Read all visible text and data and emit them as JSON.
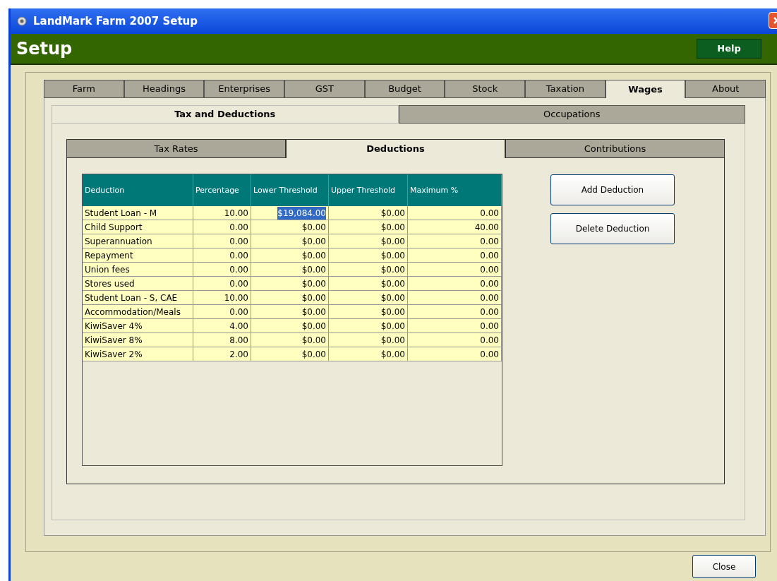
{
  "window": {
    "title": "LandMark Farm 2007 Setup"
  },
  "header": {
    "title": "Setup",
    "help_button": "Help"
  },
  "main_tabs": [
    {
      "label": "Farm",
      "selected": false
    },
    {
      "label": "Headings",
      "selected": false
    },
    {
      "label": "Enterprises",
      "selected": false
    },
    {
      "label": "GST",
      "selected": false
    },
    {
      "label": "Budget",
      "selected": false
    },
    {
      "label": "Stock",
      "selected": false
    },
    {
      "label": "Taxation",
      "selected": false
    },
    {
      "label": "Wages",
      "selected": true
    },
    {
      "label": "About",
      "selected": false
    }
  ],
  "sub_tabs": [
    {
      "label": "Tax and Deductions",
      "selected": true
    },
    {
      "label": "Occupations",
      "selected": false
    }
  ],
  "section_tabs": [
    {
      "label": "Tax Rates",
      "selected": false
    },
    {
      "label": "Deductions",
      "selected": true
    },
    {
      "label": "Contributions",
      "selected": false
    }
  ],
  "table": {
    "columns": [
      "Deduction",
      "Percentage",
      "Lower Threshold",
      "Upper Threshold",
      "Maximum %"
    ],
    "rows": [
      {
        "cells": [
          {
            "text": "Student Loan - M",
            "selected": false
          },
          {
            "text": "10.00",
            "selected": false
          },
          {
            "text": "$19,084.00",
            "selected": true
          },
          {
            "text": "$0.00",
            "selected": false
          },
          {
            "text": "0.00",
            "selected": false
          }
        ]
      },
      {
        "cells": [
          {
            "text": "Child Support",
            "selected": false
          },
          {
            "text": "0.00",
            "selected": false
          },
          {
            "text": "$0.00",
            "selected": false
          },
          {
            "text": "$0.00",
            "selected": false
          },
          {
            "text": "40.00",
            "selected": false
          }
        ]
      },
      {
        "cells": [
          {
            "text": "Superannuation",
            "selected": false
          },
          {
            "text": "0.00",
            "selected": false
          },
          {
            "text": "$0.00",
            "selected": false
          },
          {
            "text": "$0.00",
            "selected": false
          },
          {
            "text": "0.00",
            "selected": false
          }
        ]
      },
      {
        "cells": [
          {
            "text": "Repayment",
            "selected": false
          },
          {
            "text": "0.00",
            "selected": false
          },
          {
            "text": "$0.00",
            "selected": false
          },
          {
            "text": "$0.00",
            "selected": false
          },
          {
            "text": "0.00",
            "selected": false
          }
        ]
      },
      {
        "cells": [
          {
            "text": "Union fees",
            "selected": false
          },
          {
            "text": "0.00",
            "selected": false
          },
          {
            "text": "$0.00",
            "selected": false
          },
          {
            "text": "$0.00",
            "selected": false
          },
          {
            "text": "0.00",
            "selected": false
          }
        ]
      },
      {
        "cells": [
          {
            "text": "Stores used",
            "selected": false
          },
          {
            "text": "0.00",
            "selected": false
          },
          {
            "text": "$0.00",
            "selected": false
          },
          {
            "text": "$0.00",
            "selected": false
          },
          {
            "text": "0.00",
            "selected": false
          }
        ]
      },
      {
        "cells": [
          {
            "text": "Student Loan - S, CAE",
            "selected": false
          },
          {
            "text": "10.00",
            "selected": false
          },
          {
            "text": "$0.00",
            "selected": false
          },
          {
            "text": "$0.00",
            "selected": false
          },
          {
            "text": "0.00",
            "selected": false
          }
        ]
      },
      {
        "cells": [
          {
            "text": "Accommodation/Meals",
            "selected": false
          },
          {
            "text": "0.00",
            "selected": false
          },
          {
            "text": "$0.00",
            "selected": false
          },
          {
            "text": "$0.00",
            "selected": false
          },
          {
            "text": "0.00",
            "selected": false
          }
        ]
      },
      {
        "cells": [
          {
            "text": "KiwiSaver 4%",
            "selected": false
          },
          {
            "text": "4.00",
            "selected": false
          },
          {
            "text": "$0.00",
            "selected": false
          },
          {
            "text": "$0.00",
            "selected": false
          },
          {
            "text": "0.00",
            "selected": false
          }
        ]
      },
      {
        "cells": [
          {
            "text": "KiwiSaver 8%",
            "selected": false
          },
          {
            "text": "8.00",
            "selected": false
          },
          {
            "text": "$0.00",
            "selected": false
          },
          {
            "text": "$0.00",
            "selected": false
          },
          {
            "text": "0.00",
            "selected": false
          }
        ]
      },
      {
        "cells": [
          {
            "text": "KiwiSaver 2%",
            "selected": false
          },
          {
            "text": "2.00",
            "selected": false
          },
          {
            "text": "$0.00",
            "selected": false
          },
          {
            "text": "$0.00",
            "selected": false
          },
          {
            "text": "0.00",
            "selected": false
          }
        ]
      }
    ]
  },
  "buttons": [
    "Add Deduction",
    "Delete Deduction"
  ],
  "close_button": "Close"
}
